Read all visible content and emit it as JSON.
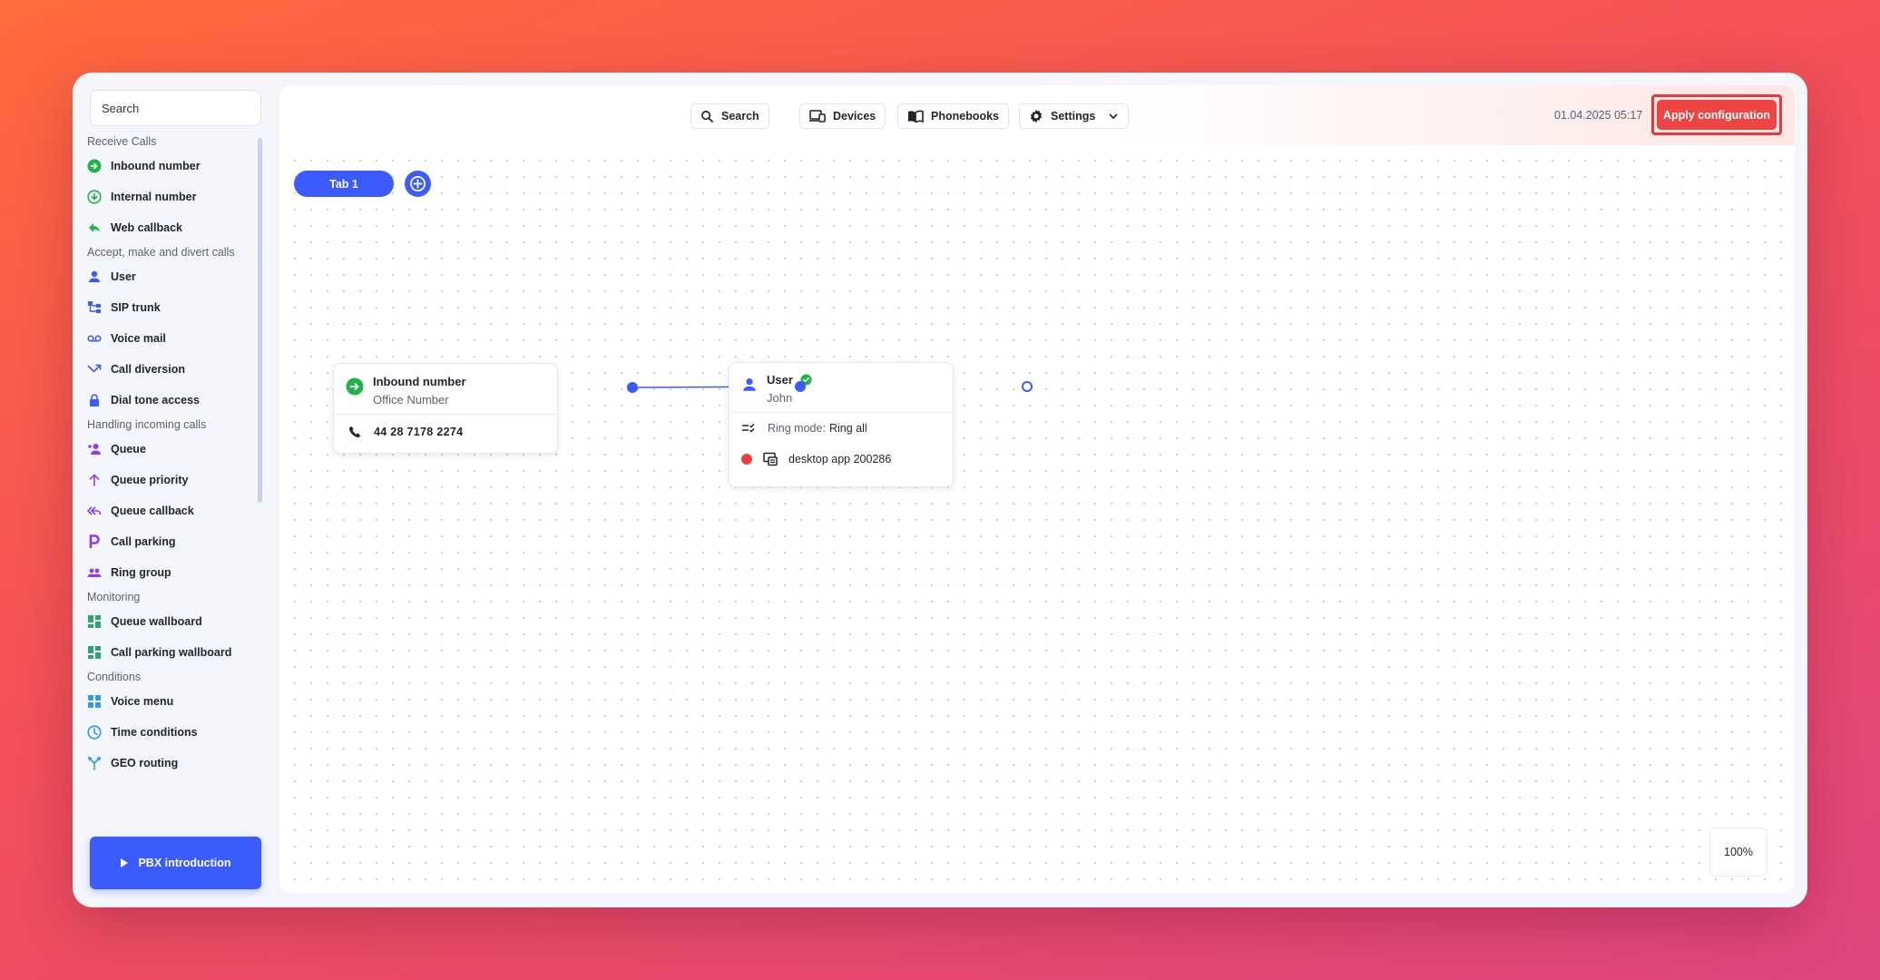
{
  "sidebar": {
    "search_placeholder": "Search",
    "sections": [
      {
        "title": "Receive Calls",
        "items": [
          {
            "label": "Inbound number",
            "icon": "inbound-icon"
          },
          {
            "label": "Internal number",
            "icon": "internal-number-icon"
          },
          {
            "label": "Web callback",
            "icon": "web-callback-icon"
          }
        ]
      },
      {
        "title": "Accept, make and divert calls",
        "items": [
          {
            "label": "User",
            "icon": "user-icon"
          },
          {
            "label": "SIP trunk",
            "icon": "sip-trunk-icon"
          },
          {
            "label": "Voice mail",
            "icon": "voicemail-icon"
          },
          {
            "label": "Call diversion",
            "icon": "call-diversion-icon"
          },
          {
            "label": "Dial tone access",
            "icon": "lock-icon"
          }
        ]
      },
      {
        "title": "Handling incoming calls",
        "items": [
          {
            "label": "Queue",
            "icon": "queue-icon"
          },
          {
            "label": "Queue priority",
            "icon": "arrow-up-icon"
          },
          {
            "label": "Queue callback",
            "icon": "queue-callback-icon"
          },
          {
            "label": "Call parking",
            "icon": "parking-icon"
          },
          {
            "label": "Ring group",
            "icon": "group-icon"
          }
        ]
      },
      {
        "title": "Monitoring",
        "items": [
          {
            "label": "Queue wallboard",
            "icon": "dashboard-icon"
          },
          {
            "label": "Call parking wallboard",
            "icon": "dashboard-icon"
          }
        ]
      },
      {
        "title": "Conditions",
        "items": [
          {
            "label": "Voice menu",
            "icon": "grid-icon"
          },
          {
            "label": "Time conditions",
            "icon": "clock-icon"
          },
          {
            "label": "GEO routing",
            "icon": "split-icon"
          }
        ]
      }
    ],
    "pbx_button": "PBX introduction"
  },
  "toolbar": {
    "search": "Search",
    "devices": "Devices",
    "phonebooks": "Phonebooks",
    "settings": "Settings",
    "datetime": "01.04.2025 05:17",
    "apply": "Apply configuration"
  },
  "tabs": [
    {
      "label": "Tab 1"
    }
  ],
  "nodes": {
    "inbound": {
      "title": "Inbound number",
      "subtitle": "Office Number",
      "phone": "44 28 7178 2274"
    },
    "user": {
      "title": "User",
      "subtitle": "John",
      "ring_mode_label": "Ring mode:",
      "ring_mode_value": "Ring all",
      "device": "desktop app 200286"
    }
  },
  "zoom": "100%",
  "colors": {
    "accent": "#3b5bfd",
    "apply": "#ef4444",
    "ok": "#22b24c",
    "offline": "#ef3e3e"
  }
}
